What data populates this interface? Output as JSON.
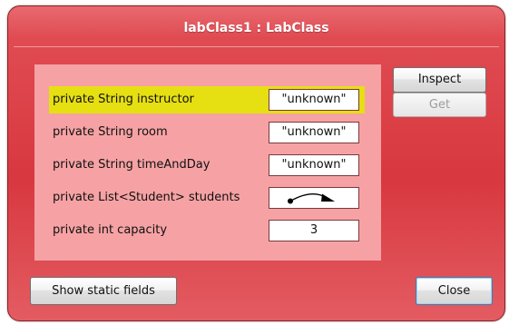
{
  "window": {
    "title": "labClass1 : LabClass"
  },
  "fields": [
    {
      "label": "private String instructor",
      "value": "\"unknown\"",
      "selected": true
    },
    {
      "label": "private String room",
      "value": "\"unknown\"",
      "selected": false
    },
    {
      "label": "private String timeAndDay",
      "value": "\"unknown\"",
      "selected": false
    },
    {
      "label": "private List<Student> students",
      "value": "",
      "value_icon": "object-reference-arrow-icon",
      "selected": false
    },
    {
      "label": "private int capacity",
      "value": "3",
      "selected": false
    }
  ],
  "buttons": {
    "inspect": "Inspect",
    "get": "Get",
    "show_static": "Show static fields",
    "close": "Close"
  },
  "colors": {
    "window_red": "#d8383f",
    "panel_pink": "#f6a2a4",
    "selection_yellow": "#e6df12"
  }
}
